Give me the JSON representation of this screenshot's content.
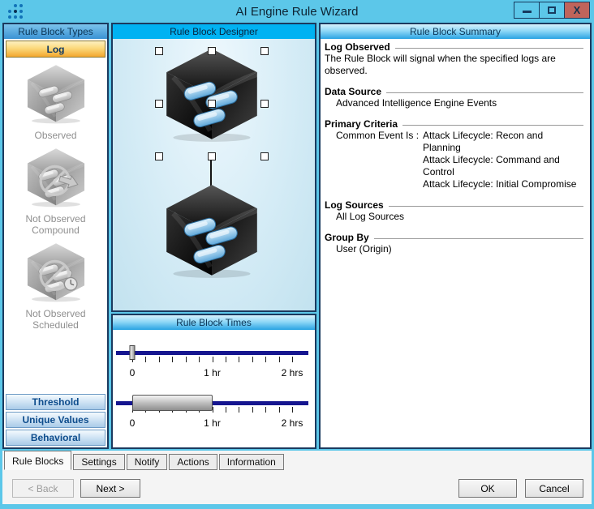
{
  "window": {
    "title": "AI Engine Rule Wizard",
    "close_glyph": "X"
  },
  "colors": {
    "titlebar": "#5cc7e9",
    "close_button": "#c0645b",
    "panel_border": "#1b3a5f",
    "designer_header": "#00b2f2",
    "log_button_orange": "#f3a72e",
    "slider_track_navy": "#15158f"
  },
  "left_panel": {
    "header": "Rule Block Types",
    "log_button": "Log",
    "items": [
      {
        "label": "Observed",
        "icon": "log-observed-cube-icon",
        "overlay": "none"
      },
      {
        "label": "Not Observed Compound",
        "icon": "not-observed-compound-icon",
        "overlay": "arrow"
      },
      {
        "label": "Not Observed Scheduled",
        "icon": "not-observed-scheduled-icon",
        "overlay": "clock"
      }
    ],
    "bottom_buttons": [
      "Threshold",
      "Unique Values",
      "Behavioral"
    ]
  },
  "designer": {
    "header": "Rule Block Designer"
  },
  "times": {
    "header": "Rule Block Times",
    "sliders": [
      {
        "kind": "thumb",
        "thumb_pct": 0,
        "ticks": 13,
        "labels": [
          {
            "text": "0",
            "pct": 0
          },
          {
            "text": "1 hr",
            "pct": 50
          },
          {
            "text": "2 hrs",
            "pct": 100
          }
        ]
      },
      {
        "kind": "range",
        "range_pct": [
          0,
          50
        ],
        "ticks": 13,
        "labels": [
          {
            "text": "0",
            "pct": 0
          },
          {
            "text": "1 hr",
            "pct": 50
          },
          {
            "text": "2 hrs",
            "pct": 100
          }
        ]
      }
    ]
  },
  "summary": {
    "header": "Rule Block Summary",
    "sections": [
      {
        "heading": "Log Observed",
        "lines": [
          "The Rule Block will signal when the specified logs are observed."
        ],
        "indent": false
      },
      {
        "heading": "Data Source",
        "lines": [
          "Advanced Intelligence Engine Events"
        ],
        "indent": true
      },
      {
        "heading": "Primary Criteria",
        "prefix": "Common Event Is :",
        "values": [
          "Attack Lifecycle: Recon and Planning",
          "Attack Lifecycle: Command and Control",
          "Attack Lifecycle: Initial Compromise"
        ]
      },
      {
        "heading": "Log Sources",
        "lines": [
          "All Log Sources"
        ],
        "indent": true
      },
      {
        "heading": "Group By",
        "lines": [
          "User (Origin)"
        ],
        "indent": true
      }
    ]
  },
  "tabs": [
    "Rule Blocks",
    "Settings",
    "Notify",
    "Actions",
    "Information"
  ],
  "footer": {
    "back": "< Back",
    "next": "Next >",
    "ok": "OK",
    "cancel": "Cancel"
  }
}
